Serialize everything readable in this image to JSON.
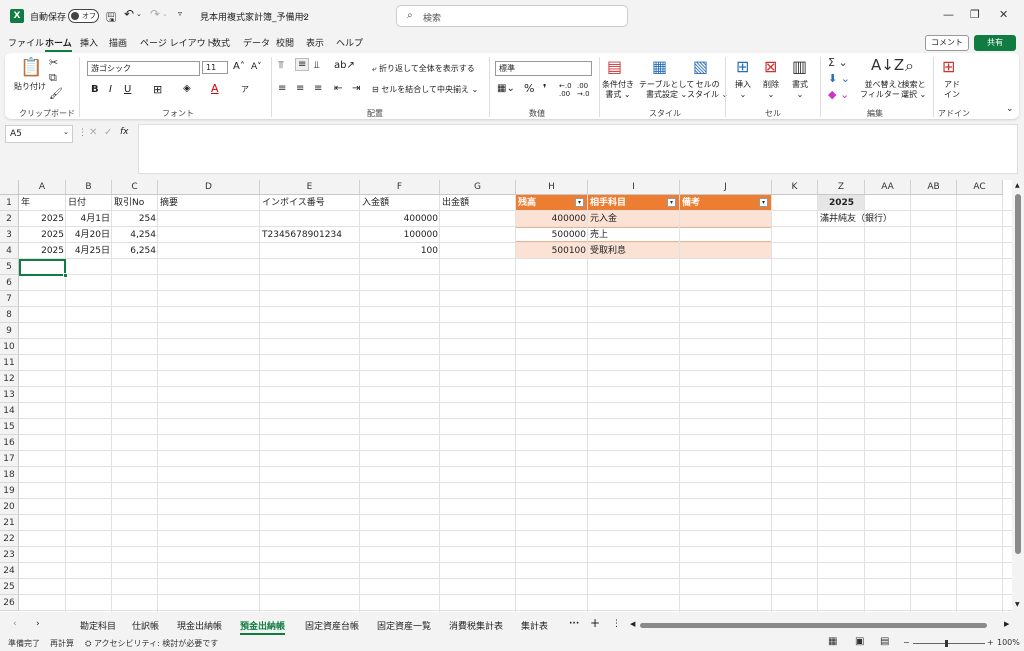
{
  "titlebar": {
    "app_icon": "X",
    "autosave_label": "自動保存",
    "autosave_state": "オフ",
    "filename": "見本用複式家計簿_予備用2",
    "search_placeholder": "検索"
  },
  "menu": {
    "items": [
      "ファイル",
      "ホーム",
      "挿入",
      "描画",
      "ページ レイアウト",
      "数式",
      "データ",
      "校閲",
      "表示",
      "ヘルプ"
    ],
    "active": "ホーム",
    "comment_label": "コメント",
    "share_label": "共有"
  },
  "ribbon": {
    "clipboard": {
      "paste": "貼り付け",
      "group": "クリップボード"
    },
    "font": {
      "name": "游ゴシック",
      "size": "11",
      "group": "フォント"
    },
    "alignment": {
      "wrap": "折り返して全体を表示する",
      "merge": "セルを結合して中央揃え",
      "group": "配置"
    },
    "number": {
      "format": "標準",
      "group": "数値"
    },
    "styles": {
      "conditional": [
        "条件付き",
        "書式"
      ],
      "table": [
        "テーブルとして",
        "書式設定"
      ],
      "cell": [
        "セルの",
        "スタイル"
      ],
      "group": "スタイル"
    },
    "cells": {
      "insert": "挿入",
      "delete": "削除",
      "format": "書式",
      "group": "セル"
    },
    "editing": {
      "sort": [
        "並べ替えと",
        "フィルター"
      ],
      "find": [
        "検索と",
        "選択"
      ],
      "group": "編集"
    },
    "addins": {
      "label": [
        "アド",
        "イン"
      ],
      "group": "アドイン"
    }
  },
  "formula_bar": {
    "name_box": "A5",
    "fx": "fx",
    "content": ""
  },
  "columns": [
    "A",
    "B",
    "C",
    "D",
    "E",
    "F",
    "G",
    "H",
    "I",
    "J",
    "K",
    "Z",
    "AA",
    "AB",
    "AC"
  ],
  "rows": [
    "1",
    "2",
    "3",
    "4",
    "5",
    "6",
    "7",
    "8",
    "9",
    "10",
    "11",
    "12",
    "13",
    "14",
    "15",
    "16",
    "17",
    "18",
    "19",
    "20",
    "21",
    "22",
    "23",
    "24",
    "25",
    "26"
  ],
  "cells": {
    "r1": {
      "A": "年",
      "B": "日付",
      "C": "取引No",
      "D": "摘要",
      "E": "インボイス番号",
      "F": "入金額",
      "G": "出金額",
      "H": "残高",
      "I": "相手科目",
      "J": "備考",
      "Z": "2025"
    },
    "r2": {
      "A": "2025",
      "B": "4月1日",
      "C": "254",
      "F": "400000",
      "H": "400000",
      "I": "元入金",
      "Z": "滿井純友（銀行）"
    },
    "r3": {
      "A": "2025",
      "B": "4月20日",
      "C": "4,254",
      "E": "T2345678901234",
      "F": "100000",
      "H": "500000",
      "I": "売上"
    },
    "r4": {
      "A": "2025",
      "B": "4月25日",
      "C": "6,254",
      "F": "100",
      "H": "500100",
      "I": "受取利息"
    }
  },
  "sheets": [
    "勘定科目",
    "仕訳帳",
    "現金出納帳",
    "預金出納帳",
    "固定資産台帳",
    "固定資産一覧",
    "消費税集計表",
    "集計表"
  ],
  "active_sheet": "預金出納帳",
  "status": {
    "ready": "準備完了",
    "recalc": "再計算",
    "accessibility": "アクセシビリティ: 検討が必要です",
    "zoom": "100%"
  },
  "colors": {
    "brand": "#107c41",
    "table_header": "#ed7d31",
    "table_band": "#fbe2d5"
  }
}
